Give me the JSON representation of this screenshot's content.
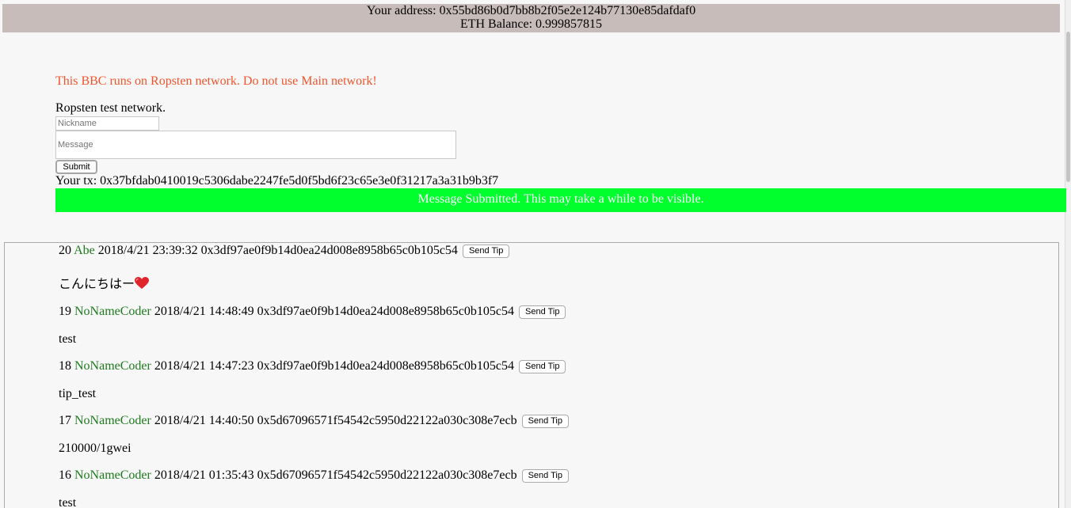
{
  "header": {
    "address_line": "Your address: 0x55bd86b0d7bb8b2f05e2e124b77130e85dafdaf0",
    "balance_line": "ETH Balance: 0.999857815"
  },
  "warning": "This BBC runs on Ropsten network. Do not use Main network!",
  "network_status": "Ropsten test network.",
  "form": {
    "nickname_placeholder": "Nickname",
    "message_placeholder": "Message",
    "submit_label": "Submit"
  },
  "tx_line": "Your tx: 0x37bfdab0410019c5306dabe2247fe5d0f5bd6f23c65e3e0f31217a3a31b9b3f7",
  "notice": {
    "text": "Message Submitted. This may take a while to be visible.",
    "color": "#00ff2c"
  },
  "posts": [
    {
      "id": "20",
      "nickname": "Abe",
      "datetime": "2018/4/21 23:39:32",
      "address": "0x3df97ae0f9b14d0ea24d008e8958b65c0b105c54",
      "tip_label": "Send Tip",
      "message": "こんにちはー",
      "icon": "heart-icon"
    },
    {
      "id": "19",
      "nickname": "NoNameCoder",
      "datetime": "2018/4/21 14:48:49",
      "address": "0x3df97ae0f9b14d0ea24d008e8958b65c0b105c54",
      "tip_label": "Send Tip",
      "message": "test"
    },
    {
      "id": "18",
      "nickname": "NoNameCoder",
      "datetime": "2018/4/21 14:47:23",
      "address": "0x3df97ae0f9b14d0ea24d008e8958b65c0b105c54",
      "tip_label": "Send Tip",
      "message": "tip_test"
    },
    {
      "id": "17",
      "nickname": "NoNameCoder",
      "datetime": "2018/4/21 14:40:50",
      "address": "0x5d67096571f54542c5950d22122a030c308e7ecb",
      "tip_label": "Send Tip",
      "message": "210000/1gwei"
    },
    {
      "id": "16",
      "nickname": "NoNameCoder",
      "datetime": "2018/4/21 01:35:43",
      "address": "0x5d67096571f54542c5950d22122a030c308e7ecb",
      "tip_label": "Send Tip",
      "message": "test"
    }
  ],
  "colors": {
    "header_bg": "#c8bcba",
    "warning": "#f2542d",
    "nickname": "#1e7a1e"
  }
}
